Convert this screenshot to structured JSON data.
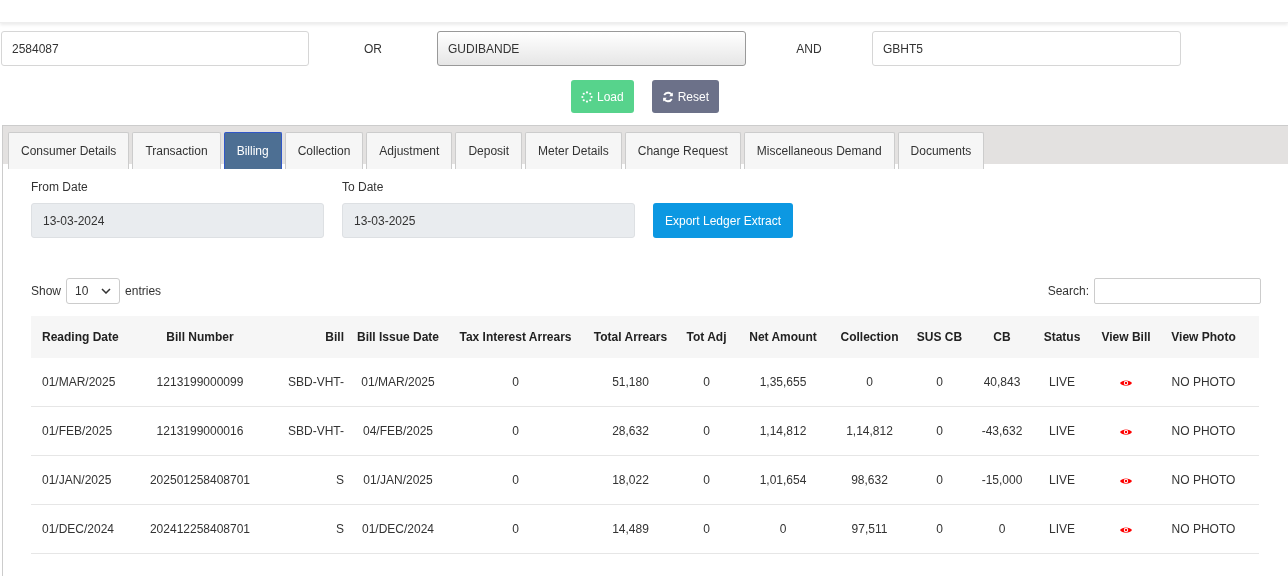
{
  "search": {
    "consumer_id": "2584087",
    "or_label": "OR",
    "subdivision": "GUDIBANDE",
    "and_label": "AND",
    "code": "GBHT5"
  },
  "buttons": {
    "load": "Load",
    "reset": "Reset"
  },
  "tabs": [
    {
      "label": "Consumer Details",
      "selected": false
    },
    {
      "label": "Transaction",
      "selected": false
    },
    {
      "label": "Billing",
      "selected": true
    },
    {
      "label": "Collection",
      "selected": false
    },
    {
      "label": "Adjustment",
      "selected": false
    },
    {
      "label": "Deposit",
      "selected": false
    },
    {
      "label": "Meter Details",
      "selected": false
    },
    {
      "label": "Change Request",
      "selected": false
    },
    {
      "label": "Miscellaneous Demand",
      "selected": false
    },
    {
      "label": "Documents",
      "selected": false
    }
  ],
  "filters": {
    "from_label": "From Date",
    "from_value": "13-03-2024",
    "to_label": "To Date",
    "to_value": "13-03-2025",
    "export_button": "Export Ledger Extract"
  },
  "table_controls": {
    "show_label": "Show",
    "page_size": "10",
    "entries_label": "entries",
    "search_label": "Search:"
  },
  "table": {
    "columns": [
      "Reading Date",
      "Bill Number",
      "Bill",
      "Bill Issue Date",
      "Tax Interest Arrears",
      "Total Arrears",
      "Tot Adj",
      "Net Amount",
      "Collection",
      "SUS CB",
      "CB",
      "Status",
      "View Bill",
      "View Photo"
    ],
    "rows": [
      {
        "cells": [
          "01/MAR/2025",
          "1213199000099",
          "SBD-VHT-",
          "01/MAR/2025",
          "0",
          "51,180",
          "0",
          "1,35,655",
          "0",
          "0",
          "40,843",
          "LIVE",
          "",
          "NO PHOTO"
        ]
      },
      {
        "cells": [
          "01/FEB/2025",
          "1213199000016",
          "SBD-VHT-",
          "04/FEB/2025",
          "0",
          "28,632",
          "0",
          "1,14,812",
          "1,14,812",
          "0",
          "-43,632",
          "LIVE",
          "",
          "NO PHOTO"
        ]
      },
      {
        "cells": [
          "01/JAN/2025",
          "202501258408701",
          "S",
          "01/JAN/2025",
          "0",
          "18,022",
          "0",
          "1,01,654",
          "98,632",
          "0",
          "-15,000",
          "LIVE",
          "",
          "NO PHOTO"
        ]
      },
      {
        "cells": [
          "01/DEC/2024",
          "202412258408701",
          "S",
          "01/DEC/2024",
          "0",
          "14,489",
          "0",
          "0",
          "97,511",
          "0",
          "0",
          "LIVE",
          "",
          "NO PHOTO"
        ]
      }
    ]
  }
}
